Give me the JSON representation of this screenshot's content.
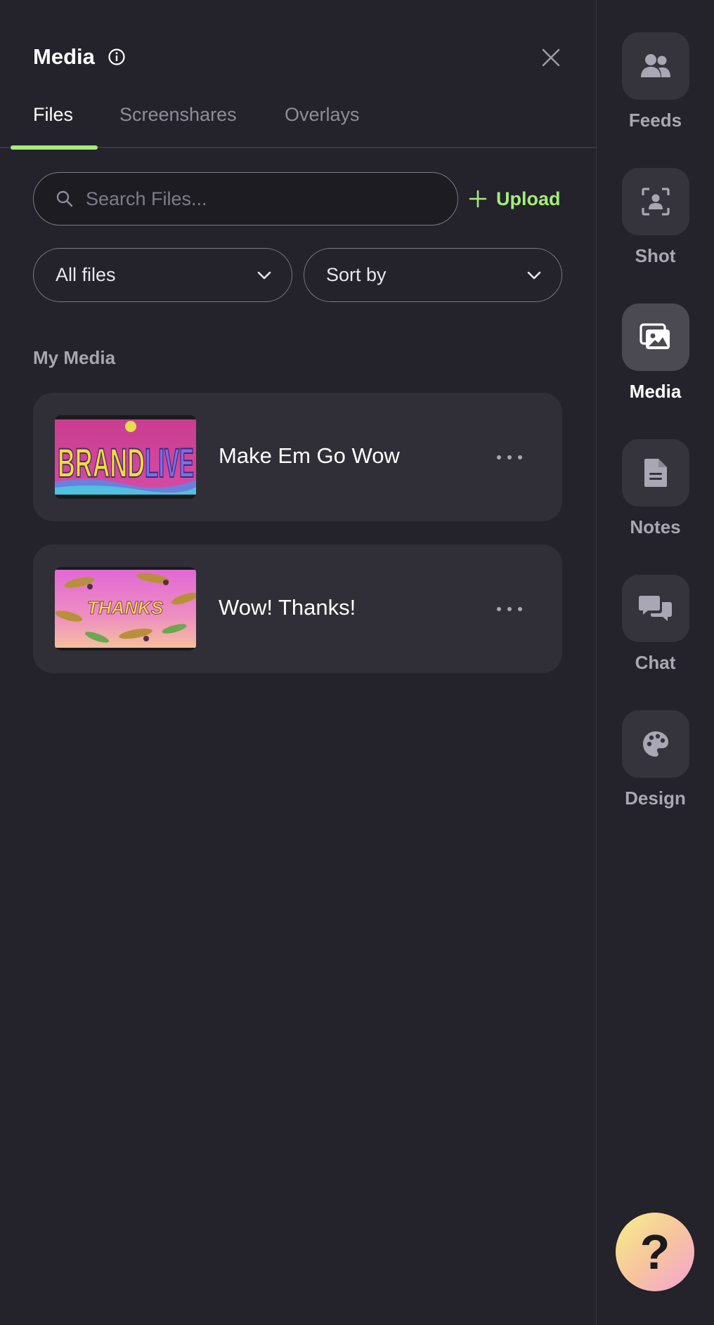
{
  "panel": {
    "title": "Media",
    "tabs": [
      {
        "label": "Files",
        "active": true
      },
      {
        "label": "Screenshares",
        "active": false
      },
      {
        "label": "Overlays",
        "active": false
      }
    ],
    "search": {
      "placeholder": "Search Files...",
      "value": ""
    },
    "upload_label": "Upload",
    "filter": {
      "selected": "All files"
    },
    "sort": {
      "selected": "Sort by"
    },
    "section_label": "My Media",
    "items": [
      {
        "name": "Make Em Go Wow",
        "thumbnail_text": "BRANDLIVE"
      },
      {
        "name": "Wow! Thanks!",
        "thumbnail_text": "THANKS"
      }
    ]
  },
  "rail": {
    "items": [
      {
        "label": "Feeds",
        "icon": "users-icon",
        "active": false
      },
      {
        "label": "Shot",
        "icon": "shot-frame-icon",
        "active": false
      },
      {
        "label": "Media",
        "icon": "images-icon",
        "active": true
      },
      {
        "label": "Notes",
        "icon": "document-icon",
        "active": false
      },
      {
        "label": "Chat",
        "icon": "chat-bubbles-icon",
        "active": false
      },
      {
        "label": "Design",
        "icon": "palette-icon",
        "active": false
      }
    ]
  },
  "help_label": "?",
  "colors": {
    "background": "#24222a",
    "accent": "#a4ec7a",
    "card": "#302f37",
    "rail_button": "#35343c",
    "rail_button_active": "#4b4a53"
  }
}
